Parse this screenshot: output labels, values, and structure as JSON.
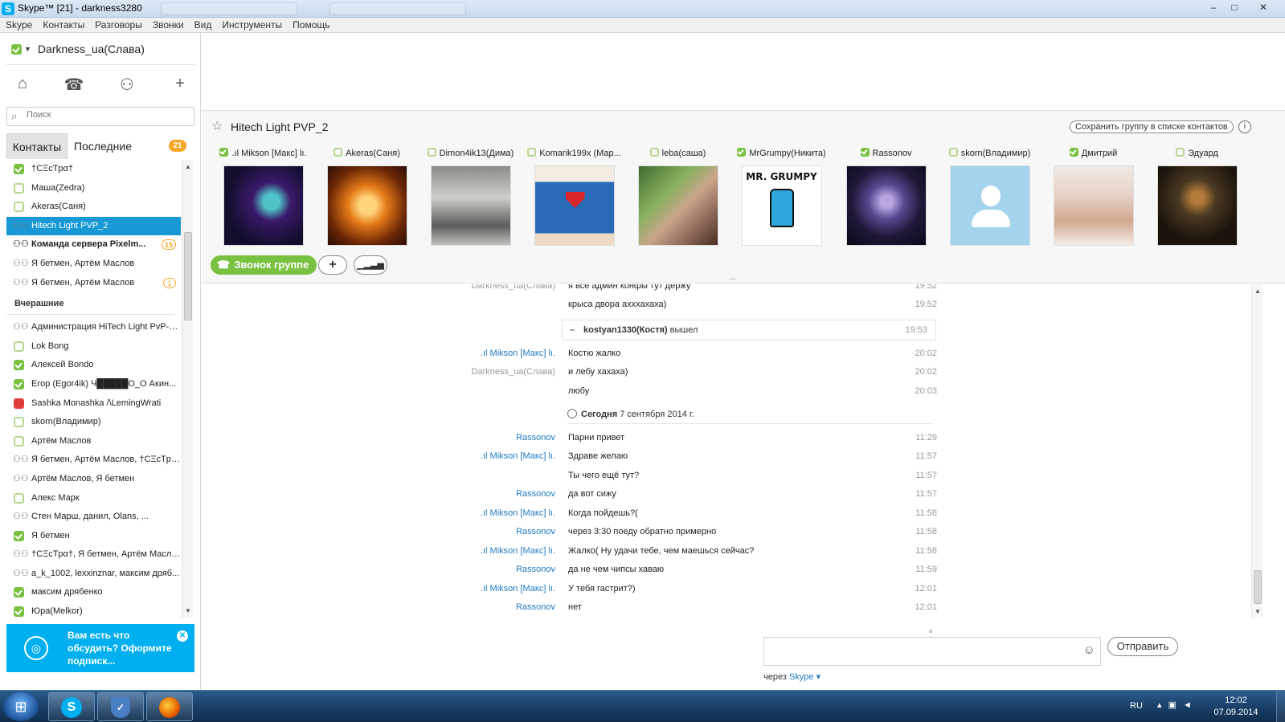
{
  "window": {
    "title": "Skype™ [21] - darkness3280",
    "app_icon": "skype-icon"
  },
  "menu": [
    "Skype",
    "Контакты",
    "Разговоры",
    "Звонки",
    "Вид",
    "Инструменты",
    "Помощь"
  ],
  "profile": {
    "name": "Darkness_ua(Слава)",
    "status": "online"
  },
  "search": {
    "placeholder": "Поиск"
  },
  "tabs": {
    "contacts": "Контакты",
    "recent": "Последние",
    "recent_badge": "21"
  },
  "contacts": [
    {
      "name": "†CΞcTpα†",
      "icon": "online"
    },
    {
      "name": "Маша(Zedra)",
      "icon": "away"
    },
    {
      "name": "Akeras(Саня)",
      "icon": "away"
    },
    {
      "name": "Hitech Light PVP_2",
      "icon": "group",
      "selected": true
    },
    {
      "name": "Команда сервера Pixelm...",
      "icon": "group",
      "bold": true,
      "badge": "15"
    },
    {
      "name": "Я бетмен, Артём Маслов",
      "icon": "group"
    },
    {
      "name": "Я бетмен, Артём Маслов",
      "icon": "group",
      "badge": "1"
    }
  ],
  "yesterday_header": "Вчерашние",
  "contacts_yesterday": [
    {
      "name": "Администрация HiTech Light PvP-P...",
      "icon": "group"
    },
    {
      "name": "Lok Bong",
      "icon": "away"
    },
    {
      "name": "Алексей Bondo",
      "icon": "online"
    },
    {
      "name": "Егор (Egor4ik) Ч█████О_О Акин...",
      "icon": "online"
    },
    {
      "name": "Sashka Monashka /\\LemingWrati",
      "icon": "busy"
    },
    {
      "name": "skorn(Владимир)",
      "icon": "away"
    },
    {
      "name": "Артём Маслов",
      "icon": "away"
    },
    {
      "name": "Я бетмен, Артём Маслов, †CΞcTpα†",
      "icon": "group"
    },
    {
      "name": "Артём Маслов, Я бетмен",
      "icon": "group"
    },
    {
      "name": "Алекс Марк",
      "icon": "away"
    },
    {
      "name": "Стен Марш, данил, Olans, ...",
      "icon": "group"
    },
    {
      "name": "Я бетмен",
      "icon": "online"
    },
    {
      "name": "†CΞcTpα†, Я бетмен, Артём Маслов",
      "icon": "group"
    },
    {
      "name": "a_k_1002, lexxinznar, максим дряб...",
      "icon": "group"
    },
    {
      "name": "максим дрябенко",
      "icon": "online"
    },
    {
      "name": "Юра(Melkor)",
      "icon": "online"
    }
  ],
  "promo": {
    "text": "Вам есть что обсудить? Оформите подписк...",
    "icon": "chat-globe-icon"
  },
  "conversation": {
    "title": "Hitech Light PVP_2",
    "save_group": "Сохранить группу в списке контактов",
    "info": "i",
    "call_group": "Звонок группе",
    "add": "+",
    "participants": [
      {
        "name": ".ıl Mikson [Макс] lı.",
        "status": "online",
        "avatar": "av1"
      },
      {
        "name": "Akeras(Саня)",
        "status": "away",
        "avatar": "av2"
      },
      {
        "name": "Dimon4ik13(Дима)",
        "status": "away",
        "avatar": "av3"
      },
      {
        "name": "Komarik199x (Мар...",
        "status": "away",
        "avatar": "av4"
      },
      {
        "name": "leba(саша)",
        "status": "away",
        "avatar": "av5"
      },
      {
        "name": "MrGrumpy(Никита)",
        "status": "online",
        "avatar": "av6",
        "avatar_text": "MR. GRUMPY"
      },
      {
        "name": "Rassonov",
        "status": "online",
        "avatar": "av7"
      },
      {
        "name": "skorn(Владимир)",
        "status": "away",
        "avatar": "av8"
      },
      {
        "name": "Дмитрий",
        "status": "online",
        "avatar": "av9"
      },
      {
        "name": "Эдуард",
        "status": "away",
        "avatar": "av10"
      }
    ]
  },
  "messages": [
    {
      "sender": "Darkness_ua(Слава)",
      "text": "я все админ конфы тут держу",
      "time": "19:52",
      "blue": false
    },
    {
      "sender": "",
      "text": "крыса двора ахххахаха)",
      "time": "19:52",
      "blue": false
    },
    {
      "event": true,
      "user": "kostyan1330(Костя)",
      "action": "вышел",
      "time": "19:53"
    },
    {
      "sender": ".ıl Mikson [Макс] lı.",
      "text": "Костю жалко",
      "time": "20:02",
      "blue": true
    },
    {
      "sender": "Darkness_ua(Слава)",
      "text": "и лебу хахаха)",
      "time": "20:02",
      "blue": false
    },
    {
      "sender": "",
      "text": "любу",
      "time": "20:03",
      "blue": false
    },
    {
      "date": true,
      "label": "Сегодня",
      "date_text": "7 сентября 2014 г."
    },
    {
      "sender": "Rassonov",
      "text": "Парни привет",
      "time": "11:29",
      "blue": true
    },
    {
      "sender": ".ıl Mikson [Макс] lı.",
      "text": "Здраве желаю",
      "time": "11:57",
      "blue": true
    },
    {
      "sender": "",
      "text": "Ты чего ещё тут?",
      "time": "11:57",
      "blue": false
    },
    {
      "sender": "Rassonov",
      "text": "да вот сижу",
      "time": "11:57",
      "blue": true
    },
    {
      "sender": ".ıl Mikson [Макс] lı.",
      "text": "Когда пойдешь?(",
      "time": "11:58",
      "blue": true
    },
    {
      "sender": "Rassonov",
      "text": "через 3:30 поеду обратно примерно",
      "time": "11:58",
      "blue": true
    },
    {
      "sender": ".ıl Mikson [Макс] lı.",
      "text": "Жалко( Ну удачи тебе, чем маешься сейчас?",
      "time": "11:58",
      "blue": true
    },
    {
      "sender": "Rassonov",
      "text": "да не чем чипсы хаваю",
      "time": "11:59",
      "blue": true
    },
    {
      "sender": ".ıl Mikson [Макс] lı.",
      "text": "У тебя гастрит?)",
      "time": "12:01",
      "blue": true
    },
    {
      "sender": "Rassonov",
      "text": "нет",
      "time": "12:01",
      "blue": true
    }
  ],
  "compose": {
    "send": "Отправить",
    "via_prefix": "через",
    "via_link": "Skype"
  },
  "taskbar": {
    "lang": "RU",
    "time": "12:02",
    "date": "07.09.2014"
  },
  "colors": {
    "accent": "#00aff0",
    "selection": "#1898d5",
    "online": "#7ac142",
    "badge": "#f5a623"
  }
}
